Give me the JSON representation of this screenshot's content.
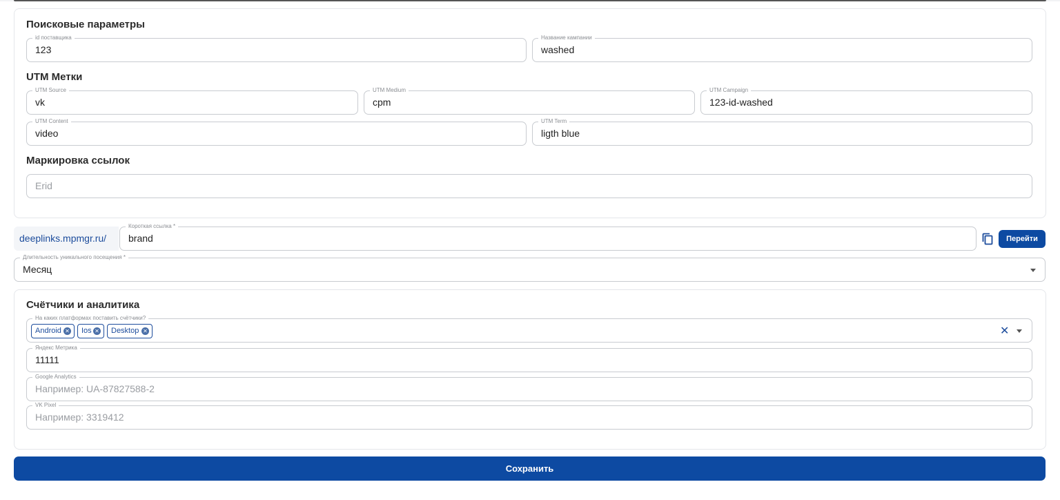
{
  "search_params": {
    "title": "Поисковые параметры",
    "supplier_id": {
      "label": "id поставщика",
      "value": "123"
    },
    "campaign_name": {
      "label": "Название кампании",
      "value": "washed"
    }
  },
  "utm": {
    "title": "UTM Метки",
    "source": {
      "label": "UTM Source",
      "value": "vk"
    },
    "medium": {
      "label": "UTM Medium",
      "value": "cpm"
    },
    "campaign": {
      "label": "UTM Campaign",
      "value": "123-id-washed"
    },
    "content": {
      "label": "UTM Content",
      "value": "video"
    },
    "term": {
      "label": "UTM Term",
      "value": "ligth blue"
    }
  },
  "marking": {
    "title": "Маркировка ссылок",
    "erid": {
      "placeholder": "Erid"
    }
  },
  "short_link": {
    "domain_prefix": "deeplinks.mpmgr.ru/",
    "label": "Короткая ссылка *",
    "value": "brand",
    "copy_icon": "copy-icon",
    "go_label": "Перейти"
  },
  "visit_duration": {
    "label": "Длительность уникального посещения *",
    "value": "Месяц"
  },
  "analytics": {
    "title": "Счётчики и аналитика",
    "platforms": {
      "label": "На каких платформах поставить счётчики?",
      "chips": [
        "Android",
        "Ios",
        "Desktop"
      ],
      "clear_icon": "clear-icon",
      "dropdown_icon": "caret-down-icon"
    },
    "yandex": {
      "label": "Яндекс Метрика",
      "value": "11111"
    },
    "google": {
      "label": "Google Analytics",
      "placeholder": "Например: UA-87827588-2"
    },
    "vk_pixel": {
      "label": "VK Pixel",
      "placeholder": "Например: 3319412"
    }
  },
  "save_label": "Сохранить",
  "colors": {
    "accent": "#0d4aa2",
    "link": "#1c4c9c"
  }
}
